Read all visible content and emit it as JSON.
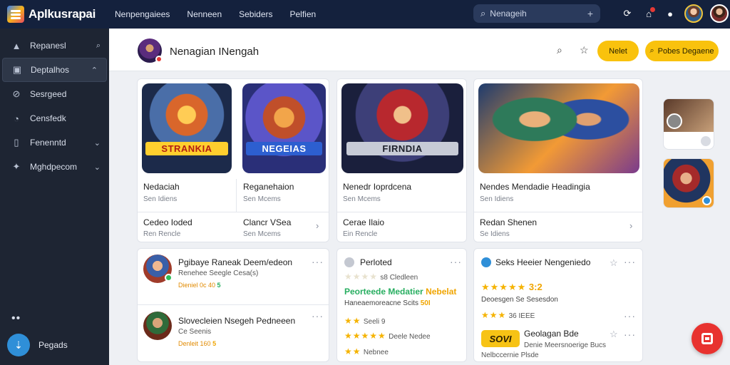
{
  "app": {
    "name": "Aplkusrapai"
  },
  "topnav": [
    "Nenpengaiees",
    "Nenneen",
    "Sebiders",
    "Pelfien"
  ],
  "search": {
    "placeholder": "Nenageih"
  },
  "sidebar": {
    "items": [
      {
        "label": "Repanesl",
        "icon": "home-icon",
        "trail": "⌕",
        "active": false
      },
      {
        "label": "Deptalhos",
        "icon": "archive-icon",
        "trail": "⌃",
        "active": true
      },
      {
        "label": "Sesrgeed",
        "icon": "link-icon",
        "trail": "",
        "active": false
      },
      {
        "label": "Censfedk",
        "icon": "clock-icon",
        "trail": "",
        "active": false
      },
      {
        "label": "Fenenntd",
        "icon": "device-icon",
        "trail": "⌄",
        "active": false
      },
      {
        "label": "Mghdpecom",
        "icon": "puzzle-icon",
        "trail": "⌄",
        "active": false
      }
    ],
    "more": "••",
    "footer_label": "Pegads"
  },
  "header": {
    "title": "Nenagian INengah",
    "button1": "Nelet",
    "button2": "Pobes Degaene"
  },
  "featured": {
    "card1": {
      "titles": [
        "Nedaciah",
        "Reganehaion"
      ],
      "subs": [
        "Sen Idiens",
        "Sen Mcems"
      ],
      "banners": [
        "STRANKIA",
        "NEGEIAS"
      ],
      "foot_titles": [
        "Cedeo Ioded",
        "Clancr VSea"
      ],
      "foot_subs": [
        "Ren Rencle",
        "Sen Mcems"
      ]
    },
    "card2": {
      "title": "Nenedr Ioprdcena",
      "sub": "Sen Mcems",
      "banner": "FIRNDIA",
      "foot_title": "Cerae Ilaio",
      "foot_sub": "Ein Rencle"
    },
    "card3": {
      "title": "Nendes Mendadie Headingia",
      "sub": "Sen Idiens",
      "foot_title": "Redan Shenen",
      "foot_sub": "Se Idiens"
    }
  },
  "lists": {
    "left": [
      {
        "title": "Pgibaye Raneak Deem/edeon",
        "sub": "Renehee Seegle Cesa(s)",
        "meta": "Dieniel 0c 40",
        "meta_tag": "5"
      },
      {
        "title": "Slovecleien Nsegeh Pedneeen",
        "sub": "Ce Seenis",
        "meta": "Denleit 160",
        "meta_tag": "5"
      }
    ],
    "middle": {
      "title": "Perloted",
      "rating_text": "s8 Cledleen",
      "highlight1": "Peorteede Medatier",
      "highlight2": "Nebelat",
      "desc": "Haneaemoreacne Scits",
      "pill": "50I",
      "row2": "Seeli 9",
      "row3": "Deele Nedee",
      "row4": "Nebnee"
    },
    "right": {
      "title": "Seks Heeier Nengeniedo",
      "rating": "3:2",
      "desc": "Deoesgen Se Sesesdon",
      "count": "36 IEEE",
      "logo": "SOVI",
      "item_title": "Geolagan Bde",
      "item_sub1": "Denie Meersnoerige Bucs",
      "item_sub2": "Nelbccernie Plsde"
    }
  },
  "colors": {
    "topbar": "#14213d",
    "sidebar": "#1e2533",
    "accent": "#f9c20d",
    "fab": "#e8322f"
  }
}
